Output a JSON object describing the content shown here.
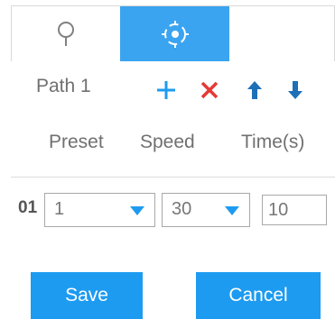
{
  "tabs": [
    {
      "icon": "pin-icon",
      "active": false
    },
    {
      "icon": "cruise-target-icon",
      "active": true
    }
  ],
  "path": {
    "label": "Path 1",
    "actions": [
      "add-icon",
      "delete-icon",
      "move-up-icon",
      "move-down-icon"
    ]
  },
  "columns": {
    "preset": "Preset",
    "speed": "Speed",
    "time": "Time(s)"
  },
  "rows": [
    {
      "index": "01",
      "preset": "1",
      "speed": "30",
      "time": "10"
    }
  ],
  "buttons": {
    "save": "Save",
    "cancel": "Cancel"
  },
  "colors": {
    "accent": "#1d9bf0",
    "active_tab": "#3aa4f0",
    "delete": "#e53935",
    "text_muted": "#707070"
  }
}
